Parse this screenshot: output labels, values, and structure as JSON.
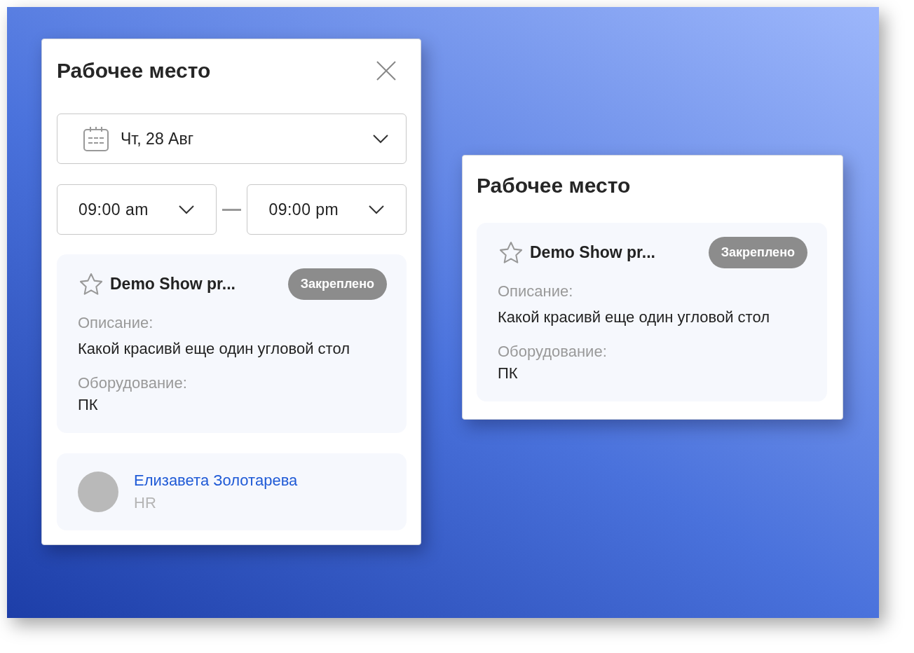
{
  "popup": {
    "title": "Рабочее место",
    "closable": true,
    "date": "Чт, 28 Авг",
    "time_from": "09:00 am",
    "time_to": "09:00 pm",
    "workspace": {
      "name": "Demo Show pr...",
      "starred": false,
      "badge": "Закреплено",
      "description_label": "Описание:",
      "description": "Какой красивй еще один угловой стол",
      "equipment_label": "Оборудование:",
      "equipment": "ПК"
    },
    "contact": {
      "name": "Елизавета Золотарева",
      "role": "HR"
    }
  },
  "card": {
    "title": "Рабочее место",
    "closable": false,
    "workspace": {
      "name": "Demo Show pr...",
      "starred": false,
      "badge": "Закреплено",
      "description_label": "Описание:",
      "description": "Какой красивй еще один угловой стол",
      "equipment_label": "Оборудование:",
      "equipment": "ПК"
    }
  }
}
